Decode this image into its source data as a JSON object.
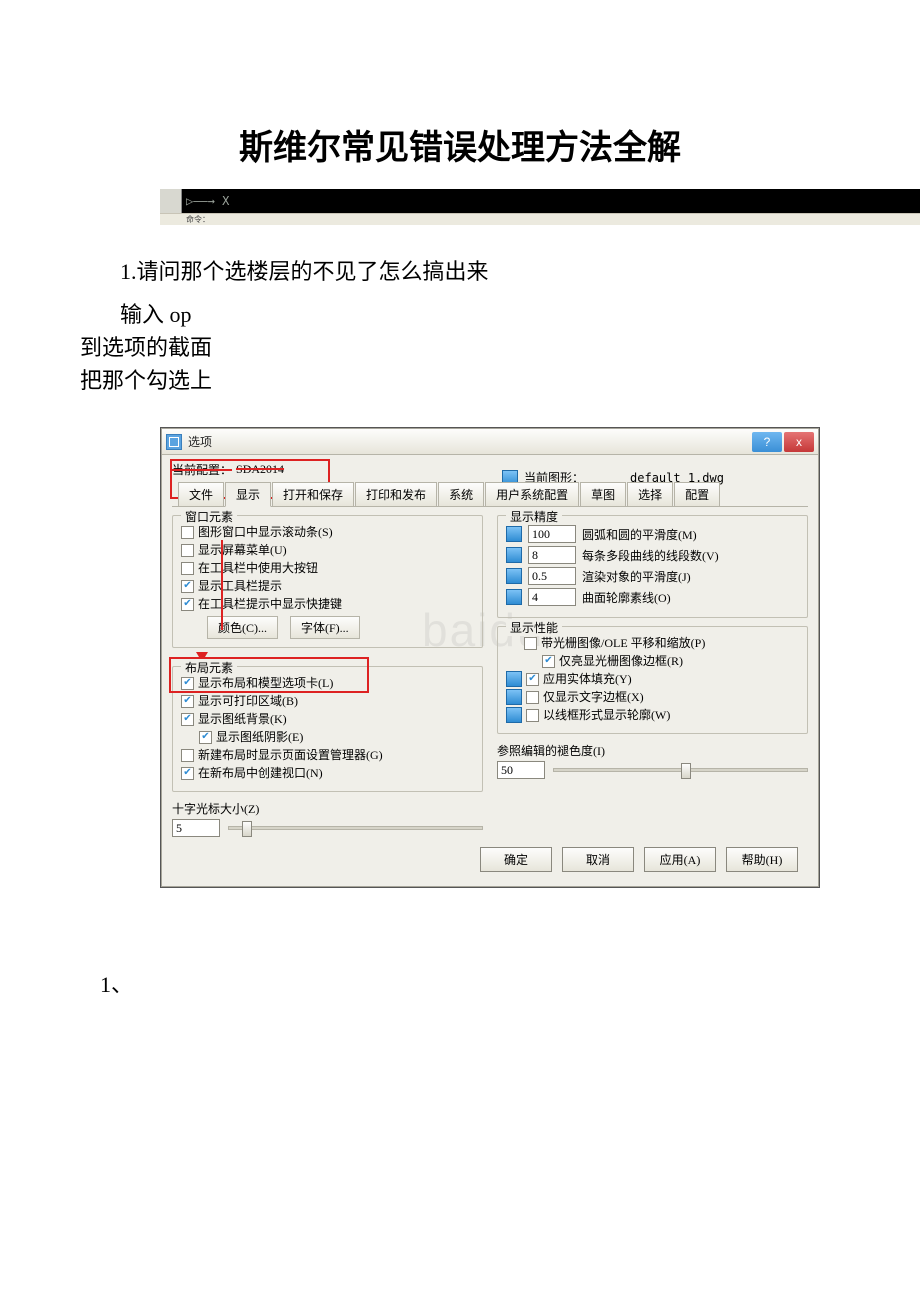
{
  "document": {
    "title": "斯维尔常见错误处理方法全解",
    "q1": "1.请问那个选楼层的不见了怎么搞出来",
    "a_line1": "输入 op",
    "a_line2": "到选项的截面",
    "a_line3": "把那个勾选上",
    "footer_num": "1、"
  },
  "console": {
    "arrow_label": "▷——→ X",
    "cmd_line": "命令："
  },
  "dialog": {
    "title": "选项",
    "help_glyph": "?",
    "close_glyph": "x",
    "current_profile_label": "当前配置：",
    "current_profile_value": "SDA2014",
    "current_drawing_label": "当前图形：",
    "current_drawing_value": "default_1.dwg",
    "tabs": [
      "文件",
      "显示",
      "打开和保存",
      "打印和发布",
      "系统",
      "用户系统配置",
      "草图",
      "选择",
      "配置"
    ],
    "groups": {
      "window": {
        "legend": "窗口元素",
        "items": [
          {
            "checked": false,
            "label": "图形窗口中显示滚动条(S)"
          },
          {
            "checked": false,
            "label": "显示屏幕菜单(U)"
          },
          {
            "checked": false,
            "label": "在工具栏中使用大按钮"
          },
          {
            "checked": true,
            "label": "显示工具栏提示"
          },
          {
            "checked": true,
            "label": "在工具栏提示中显示快捷键"
          }
        ],
        "color_btn": "颜色(C)...",
        "font_btn": "字体(F)..."
      },
      "layout": {
        "legend": "布局元素",
        "items": [
          {
            "checked": true,
            "label": "显示布局和模型选项卡(L)"
          },
          {
            "checked": true,
            "label": "显示可打印区域(B)"
          },
          {
            "checked": true,
            "label": "显示图纸背景(K)"
          },
          {
            "checked": true,
            "label": "显示图纸阴影(E)",
            "indent": true
          },
          {
            "checked": false,
            "label": "新建布局时显示页面设置管理器(G)"
          },
          {
            "checked": true,
            "label": "在新布局中创建视口(N)"
          }
        ]
      },
      "precision": {
        "legend": "显示精度",
        "rows": [
          {
            "value": "100",
            "label": "圆弧和圆的平滑度(M)"
          },
          {
            "value": "8",
            "label": "每条多段曲线的线段数(V)"
          },
          {
            "value": "0.5",
            "label": "渲染对象的平滑度(J)"
          },
          {
            "value": "4",
            "label": "曲面轮廓素线(O)"
          }
        ]
      },
      "performance": {
        "legend": "显示性能",
        "items": [
          {
            "icon": false,
            "checked": false,
            "label": "带光栅图像/OLE 平移和缩放(P)"
          },
          {
            "icon": false,
            "checked": true,
            "label": "仅亮显光栅图像边框(R)",
            "indent": true
          },
          {
            "icon": true,
            "checked": true,
            "label": "应用实体填充(Y)"
          },
          {
            "icon": true,
            "checked": false,
            "label": "仅显示文字边框(X)"
          },
          {
            "icon": true,
            "checked": false,
            "label": "以线框形式显示轮廓(W)"
          }
        ]
      }
    },
    "crosshair": {
      "label": "十字光标大小(Z)",
      "value": "5",
      "percent": 5
    },
    "xref_fade": {
      "label": "参照编辑的褪色度(I)",
      "value": "50",
      "percent": 50
    },
    "buttons": {
      "ok": "确定",
      "cancel": "取消",
      "apply": "应用(A)",
      "help": "帮助(H)"
    }
  },
  "watermark": "baidu"
}
